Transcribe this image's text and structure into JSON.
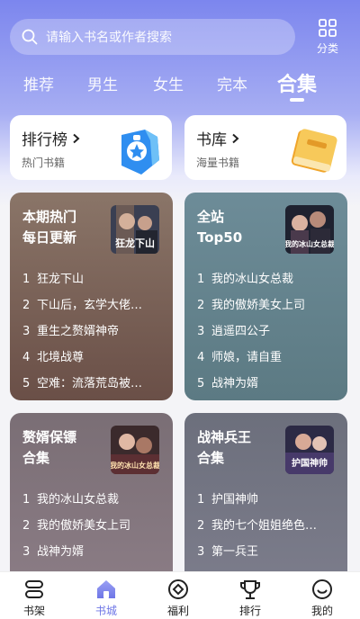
{
  "search": {
    "placeholder": "请输入书名或作者搜索"
  },
  "category_button": {
    "label": "分类"
  },
  "tabs": [
    {
      "label": "推荐",
      "active": false
    },
    {
      "label": "男生",
      "active": false
    },
    {
      "label": "女生",
      "active": false
    },
    {
      "label": "完本",
      "active": false
    },
    {
      "label": "合集",
      "active": true
    }
  ],
  "quick_links": [
    {
      "title": "排行榜",
      "subtitle": "热门书籍",
      "icon": "ranking-badge-icon"
    },
    {
      "title": "书库",
      "subtitle": "海量书籍",
      "icon": "book-library-icon"
    }
  ],
  "cards": [
    {
      "title_line1": "本期热门",
      "title_line2": "每日更新",
      "cover_text": "狂龙下山",
      "items": [
        "狂龙下山",
        "下山后，玄学大佬…",
        "重生之赘婿神帝",
        "北境战尊",
        "空难：流落荒岛被…"
      ]
    },
    {
      "title_line1": "全站",
      "title_line2": "Top50",
      "cover_text": "我的冰山女总裁",
      "items": [
        "我的冰山女总裁",
        "我的傲娇美女上司",
        "逍遥四公子",
        "师娘，请自重",
        "战神为婿"
      ]
    },
    {
      "title_line1": "赘婿保镖",
      "title_line2": "合集",
      "cover_text": "我的冰山女总裁",
      "items": [
        "我的冰山女总裁",
        "我的傲娇美女上司",
        "战神为婿",
        "……"
      ]
    },
    {
      "title_line1": "战神兵王",
      "title_line2": "合集",
      "cover_text": "护国神帅",
      "items": [
        "护国神帅",
        "我的七个姐姐绝色…",
        "第一兵王",
        "……"
      ]
    }
  ],
  "bottom_nav": [
    {
      "label": "书架",
      "icon": "bookshelf-icon",
      "active": false
    },
    {
      "label": "书城",
      "icon": "home-icon",
      "active": true
    },
    {
      "label": "福利",
      "icon": "welfare-icon",
      "active": false
    },
    {
      "label": "排行",
      "icon": "trophy-icon",
      "active": false
    },
    {
      "label": "我的",
      "icon": "profile-icon",
      "active": false
    }
  ],
  "colors": {
    "accent": "#6e76e6",
    "header_top": "#7c86ee"
  }
}
